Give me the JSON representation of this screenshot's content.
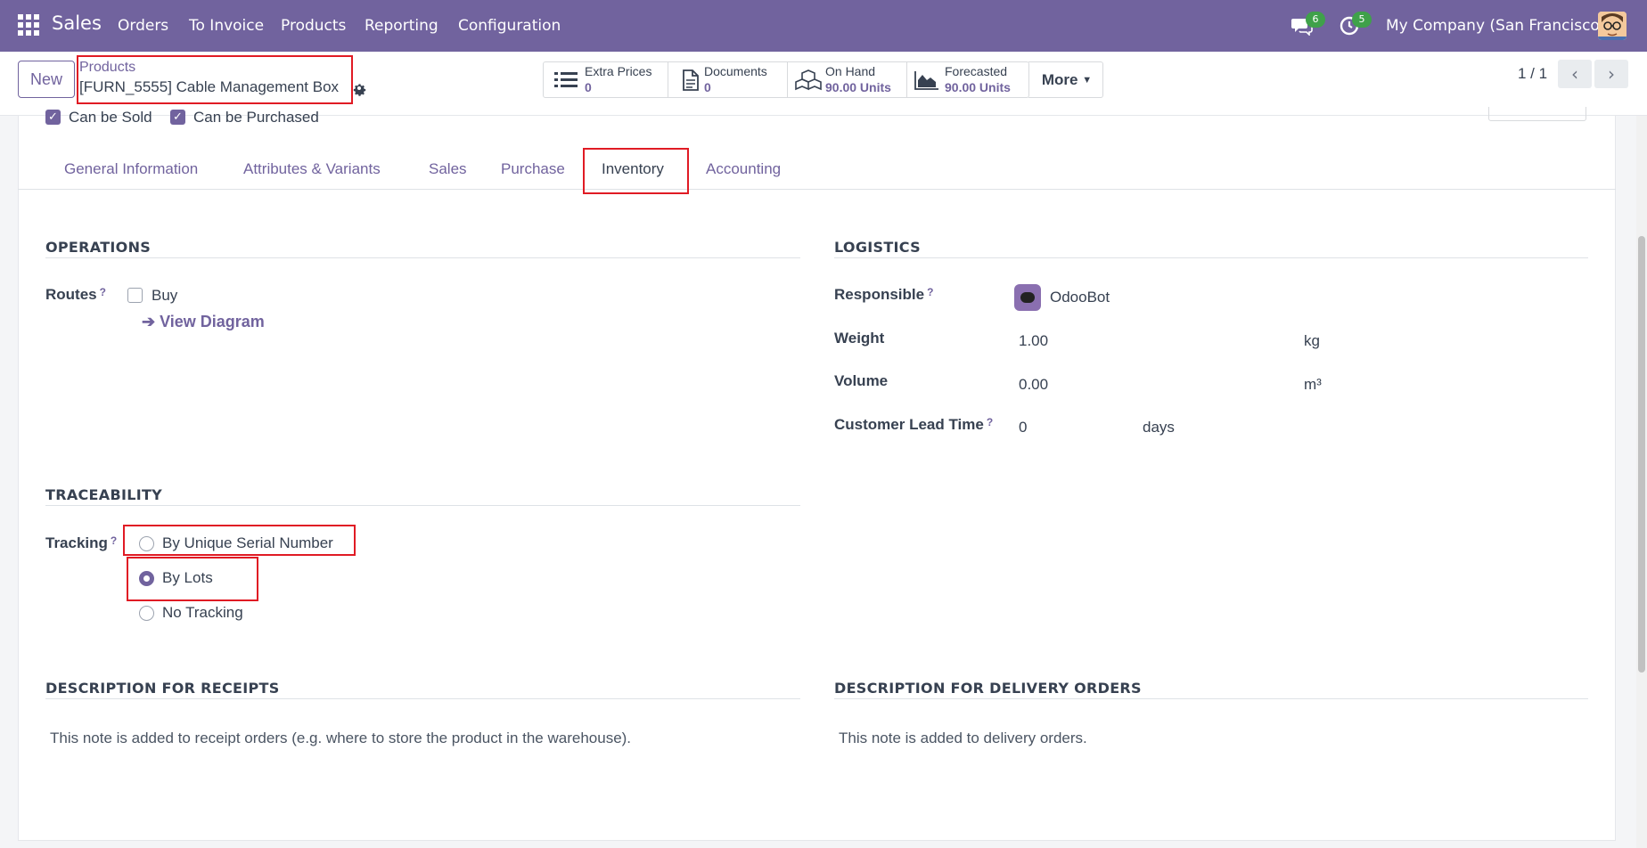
{
  "navbar": {
    "app_name": "Sales",
    "menu": [
      "Orders",
      "To Invoice",
      "Products",
      "Reporting",
      "Configuration"
    ],
    "messages_count": "6",
    "activities_count": "5",
    "company": "My Company (San Francisco)"
  },
  "control_panel": {
    "new_label": "New",
    "breadcrumb_parent": "Products",
    "breadcrumb_current": "[FURN_5555] Cable Management Box",
    "smart_buttons": [
      {
        "label": "Extra Prices",
        "value": "0",
        "icon": "list-icon"
      },
      {
        "label": "Documents",
        "value": "0",
        "icon": "document-icon"
      },
      {
        "label": "On Hand",
        "value": "90.00 Units",
        "icon": "cubes-icon"
      },
      {
        "label": "Forecasted",
        "value": "90.00 Units",
        "icon": "area-chart-icon"
      }
    ],
    "more_label": "More",
    "pager": "1 / 1"
  },
  "form": {
    "checkbox_labels": [
      "Can be Sold",
      "Can be Purchased"
    ],
    "tabs": [
      "General Information",
      "Attributes & Variants",
      "Sales",
      "Purchase",
      "Inventory",
      "Accounting"
    ],
    "active_tab": "Inventory",
    "operations": {
      "title": "OPERATIONS",
      "routes_label": "Routes",
      "route_option": "Buy",
      "view_diagram": "View Diagram"
    },
    "logistics": {
      "title": "LOGISTICS",
      "responsible_label": "Responsible",
      "responsible_value": "OdooBot",
      "weight_label": "Weight",
      "weight_value": "1.00",
      "weight_unit": "kg",
      "volume_label": "Volume",
      "volume_value": "0.00",
      "volume_unit": "m³",
      "lead_time_label": "Customer Lead Time",
      "lead_time_value": "0",
      "lead_time_unit": "days"
    },
    "traceability": {
      "title": "TRACEABILITY",
      "tracking_label": "Tracking",
      "options": [
        "By Unique Serial Number",
        "By Lots",
        "No Tracking"
      ],
      "selected": "By Lots"
    },
    "desc_receipts": {
      "title": "DESCRIPTION FOR RECEIPTS",
      "placeholder": "This note is added to receipt orders (e.g. where to store the product in the warehouse)."
    },
    "desc_delivery": {
      "title": "DESCRIPTION FOR DELIVERY ORDERS",
      "placeholder": "This note is added to delivery orders."
    }
  },
  "colors": {
    "brand": "#71639e",
    "badge": "#3fa14a",
    "highlight": "#e01b24"
  }
}
